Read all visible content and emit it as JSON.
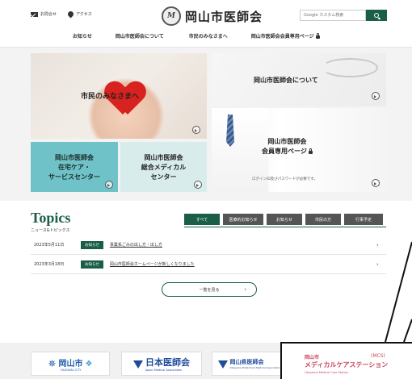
{
  "header": {
    "util_links": [
      {
        "label": "お問合せ",
        "icon": "mail-icon"
      },
      {
        "label": "アクセス",
        "icon": "map-pin-icon"
      }
    ],
    "logo_mark": "M",
    "site_title": "岡山市医師会",
    "search_placeholder": "Google カスタム検索"
  },
  "nav": [
    {
      "label": "お知らせ"
    },
    {
      "label": "岡山市医師会について"
    },
    {
      "label": "市民のみなさまへ"
    },
    {
      "label": "岡山市医師会会員専用ページ"
    }
  ],
  "hero": {
    "citizen": "市民のみなさまへ",
    "about": "岡山市医師会について",
    "member_line1": "岡山市医師会",
    "member_line2": "会員専用ページ",
    "member_note": "ログインID及びパスワードが必要です。",
    "homecare_line1": "岡山市医師会",
    "homecare_line2": "在宅ケア・",
    "homecare_line3": "サービスセンター",
    "medical_line1": "岡山市医師会",
    "medical_line2": "総合メディカル",
    "medical_line3": "センター"
  },
  "topics": {
    "title": "Topics",
    "subtitle": "ニュース&トピックス",
    "tabs": [
      "すべて",
      "医療的お知らせ",
      "お知らせ",
      "市民の方",
      "行事予定"
    ],
    "active_tab": "すべて",
    "items": [
      {
        "date": "2023年5月11日",
        "badge": "お知らせ",
        "text": "事業系ごみの出し方・出し方"
      },
      {
        "date": "2023年3月18日",
        "badge": "お知らせ",
        "text": "岡山市医師会ホームページが新しくなりました"
      }
    ],
    "more_label": "一覧を見る"
  },
  "footer_banners": {
    "b1": {
      "label": "岡山市",
      "sub": "OKAYAMA CITY"
    },
    "b2": {
      "label": "日本医師会",
      "sub": "Japan Medical Association"
    },
    "b3": {
      "label": "岡山県医師会",
      "sub": "Okayama Prefectural Medical Association"
    },
    "mcs": {
      "line1": "岡山市",
      "tag": "(MCS)",
      "line2": "メディカルケアステーション",
      "line3": "Okayama Medical Care Station"
    }
  },
  "colors": {
    "brand_green": "#1a5e47",
    "heart_red": "#d7221f",
    "teal": "#6fc2c7",
    "mcs_pink": "#c7475c"
  }
}
